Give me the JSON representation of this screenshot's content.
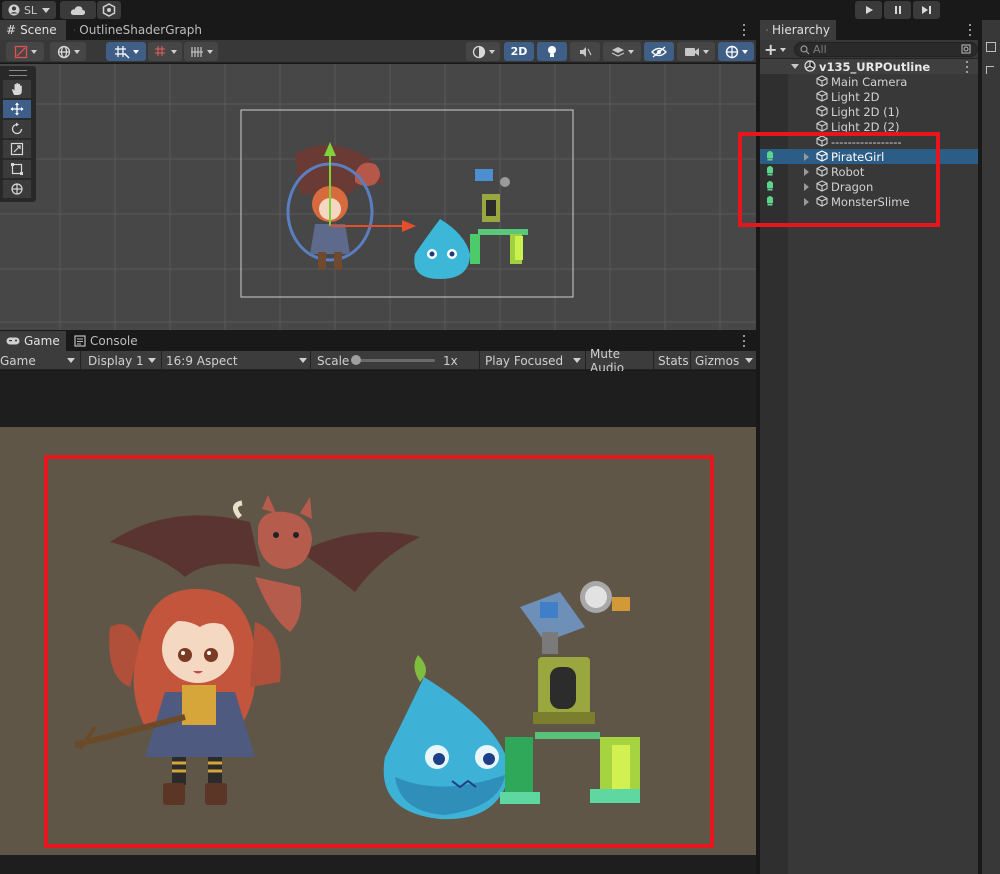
{
  "toolbar": {
    "account_label": "SL",
    "play_icon": "play-icon",
    "pause_icon": "pause-icon",
    "step_icon": "step-icon"
  },
  "scene_panel": {
    "tabs": [
      {
        "label": "Scene",
        "icon": "grid-icon"
      },
      {
        "label": "OutlineShaderGraph",
        "icon": "shader-graph-icon"
      }
    ],
    "toolbar": {
      "mode_2d_label": "2D"
    },
    "tools": [
      "view-tool",
      "move-tool",
      "rotate-tool",
      "scale-tool",
      "rect-tool",
      "transform-tool"
    ]
  },
  "game_panel": {
    "tabs": [
      {
        "label": "Game",
        "icon": "gamepad-icon"
      },
      {
        "label": "Console",
        "icon": "console-icon"
      }
    ],
    "toolbar": {
      "game_dropdown": "Game",
      "display_dropdown": "Display 1",
      "aspect_dropdown": "16:9 Aspect",
      "scale_label": "Scale",
      "scale_value": "1x",
      "scale_fraction": 0.0,
      "play_mode_dropdown": "Play Focused",
      "mute_audio_label": "Mute Audio",
      "stats_label": "Stats",
      "gizmos_label": "Gizmos"
    }
  },
  "hierarchy": {
    "title": "Hierarchy",
    "search_placeholder": "All",
    "scene_name": "v135_URPOutline",
    "items": [
      {
        "label": "Main Camera",
        "expandable": false,
        "selected": false
      },
      {
        "label": "Light 2D",
        "expandable": false,
        "selected": false
      },
      {
        "label": "Light 2D (1)",
        "expandable": false,
        "selected": false
      },
      {
        "label": "Light 2D (2)",
        "expandable": false,
        "selected": false
      },
      {
        "label": "-----------------",
        "expandable": false,
        "selected": false
      },
      {
        "label": "PirateGirl",
        "expandable": true,
        "selected": true
      },
      {
        "label": "Robot",
        "expandable": true,
        "selected": false
      },
      {
        "label": "Dragon",
        "expandable": true,
        "selected": false
      },
      {
        "label": "MonsterSlime",
        "expandable": true,
        "selected": false
      }
    ]
  },
  "colors": {
    "accent_selected": "#2c5d87",
    "highlight_red": "#e5161e",
    "game_background": "#5f5647",
    "scene_background": "#474747"
  }
}
